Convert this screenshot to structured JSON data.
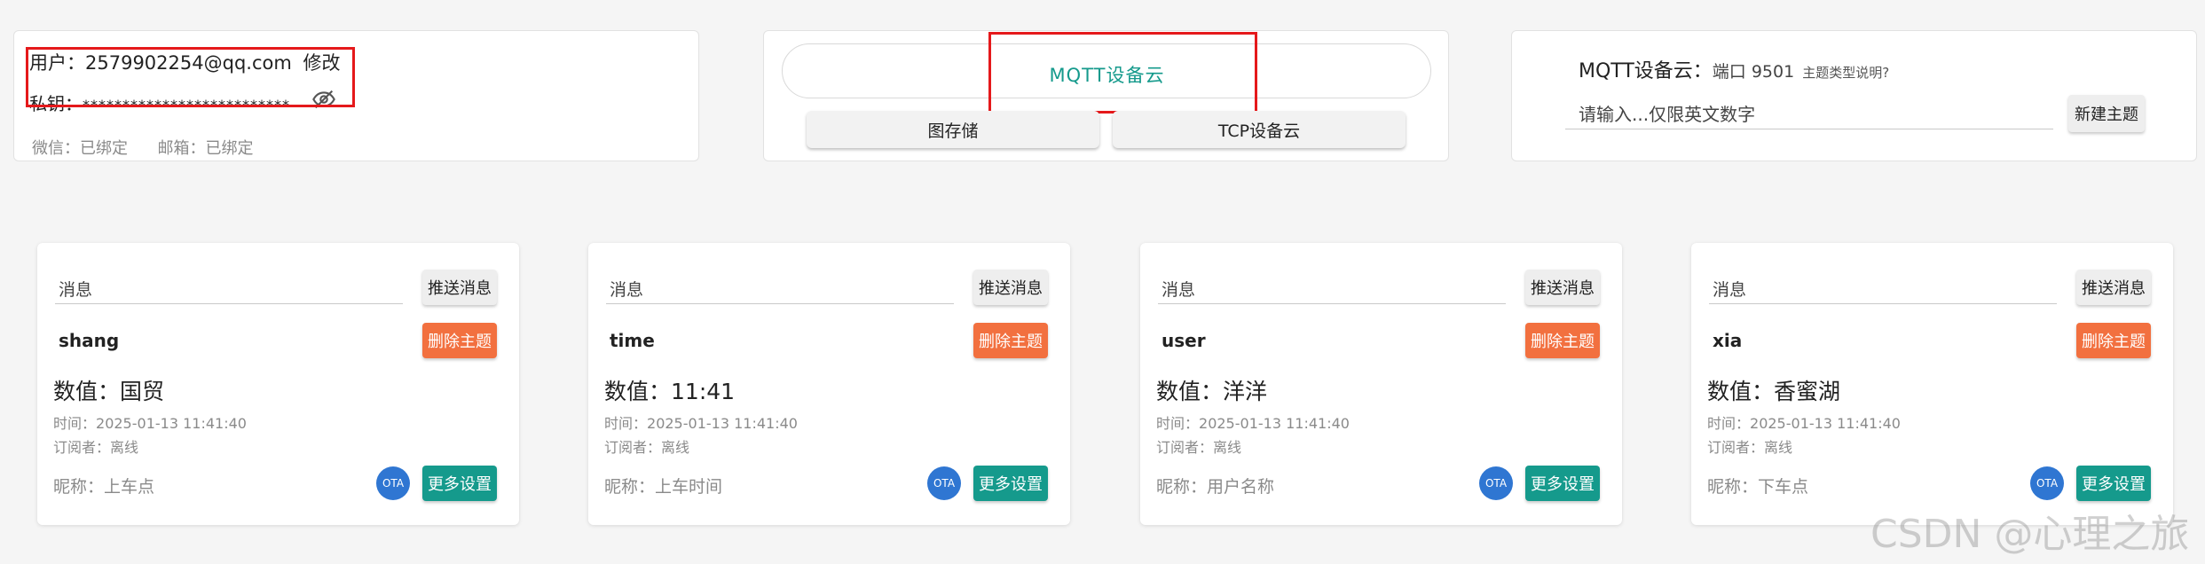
{
  "account": {
    "user_label": "用户：",
    "user_email": "2579902254@qq.com",
    "edit_link": "修改",
    "key_label": "私钥：",
    "key_masked": "**************************",
    "wechat_label": "微信：",
    "wechat_status": "已绑定",
    "email_label": "邮箱：",
    "email_status": "已绑定"
  },
  "services": {
    "active": "MQTT设备云",
    "image_storage": "图存储",
    "tcp_cloud": "TCP设备云"
  },
  "topic_creator": {
    "title": "MQTT设备云：",
    "port_label": "端口 9501",
    "help_link": "主题类型说明?",
    "input_placeholder": "请输入...仅限英文数字",
    "create_button": "新建主题"
  },
  "cards": [
    {
      "topic": "shang",
      "message_placeholder": "消息",
      "push_button": "推送消息",
      "delete_button": "删除主题",
      "value_label": "数值：",
      "value": "国贸",
      "time_label": "时间：",
      "time": "2025-01-13 11:41:40",
      "subscriber_label": "订阅者：",
      "subscriber": "离线",
      "nickname_label": "昵称：",
      "nickname": "上车点",
      "ota_label": "OTA",
      "settings_button": "更多设置"
    },
    {
      "topic": "time",
      "message_placeholder": "消息",
      "push_button": "推送消息",
      "delete_button": "删除主题",
      "value_label": "数值：",
      "value": "11:41",
      "time_label": "时间：",
      "time": "2025-01-13 11:41:40",
      "subscriber_label": "订阅者：",
      "subscriber": "离线",
      "nickname_label": "昵称：",
      "nickname": "上车时间",
      "ota_label": "OTA",
      "settings_button": "更多设置"
    },
    {
      "topic": "user",
      "message_placeholder": "消息",
      "push_button": "推送消息",
      "delete_button": "删除主题",
      "value_label": "数值：",
      "value": "洋洋",
      "time_label": "时间：",
      "time": "2025-01-13 11:41:40",
      "subscriber_label": "订阅者：",
      "subscriber": "离线",
      "nickname_label": "昵称：",
      "nickname": "用户名称",
      "ota_label": "OTA",
      "settings_button": "更多设置"
    },
    {
      "topic": "xia",
      "message_placeholder": "消息",
      "push_button": "推送消息",
      "delete_button": "删除主题",
      "value_label": "数值：",
      "value": "香蜜湖",
      "time_label": "时间：",
      "time": "2025-01-13 11:41:40",
      "subscriber_label": "订阅者：",
      "subscriber": "离线",
      "nickname_label": "昵称：",
      "nickname": "下车点",
      "ota_label": "OTA",
      "settings_button": "更多设置"
    }
  ],
  "watermark": "CSDN @心理之旅",
  "colors": {
    "accent_teal": "#159a8c",
    "danger_orange": "#f2703f",
    "ota_blue": "#2f76d2",
    "highlight_red": "#e5191b"
  },
  "icons": {
    "key_visibility": "eye-off-icon"
  }
}
